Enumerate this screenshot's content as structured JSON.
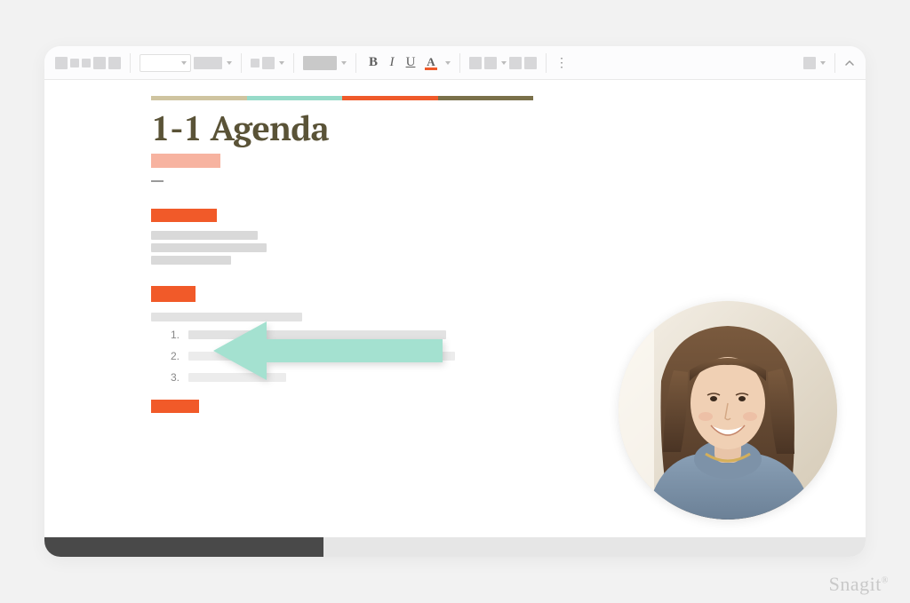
{
  "toolbar": {
    "bold": "B",
    "italic": "I",
    "underline": "U",
    "fontcolor_letter": "A",
    "more": "⋮"
  },
  "document": {
    "title": "1-1 Agenda",
    "stripe_colors": [
      "#cfc4a0",
      "#97dbc9",
      "#ef5a2a",
      "#7a704a"
    ],
    "list_numbers": [
      "1.",
      "2.",
      "3."
    ]
  },
  "annotation": {
    "arrow_color": "#a0e0cf"
  },
  "watermark": "Snagit"
}
